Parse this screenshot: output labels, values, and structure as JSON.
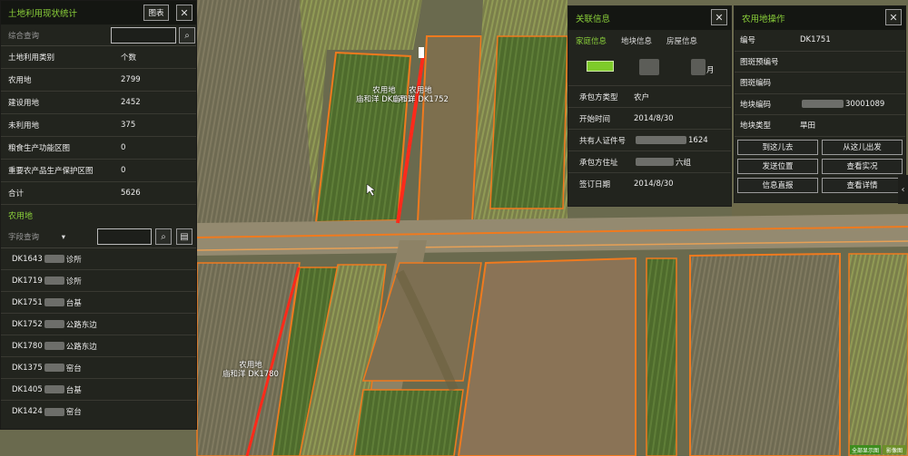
{
  "map": {
    "parcel_labels": [
      {
        "line1": "农用地",
        "line2": "庙和洋 DK1751"
      },
      {
        "line1": "农用地",
        "line2": "庙和洋 DK1752"
      },
      {
        "line1": "农用地",
        "line2": "庙和洋 DK1780"
      }
    ],
    "mini_btn_1": "全部显示图",
    "mini_btn_2": "影像图",
    "side_tab_icon": "‹"
  },
  "stats_panel": {
    "title": "土地利用现状统计",
    "chart_button": "图表",
    "search_placeholder": "综合查询",
    "header": {
      "k": "土地利用类别",
      "v": "个数"
    },
    "rows": [
      {
        "k": "农用地",
        "v": "2799"
      },
      {
        "k": "建设用地",
        "v": "2452"
      },
      {
        "k": "未利用地",
        "v": "375"
      },
      {
        "k": "粮食生产功能区图",
        "v": "0"
      },
      {
        "k": "重要农产品生产保护区图",
        "v": "0"
      },
      {
        "k": "合计",
        "v": "5626"
      }
    ],
    "subtitle": "农用地",
    "field_select": "字段查询",
    "list": [
      {
        "code": "DK1643",
        "place": "诊所"
      },
      {
        "code": "DK1719",
        "place": "诊所"
      },
      {
        "code": "DK1751",
        "place": "台基"
      },
      {
        "code": "DK1752",
        "place": "公路东边"
      },
      {
        "code": "DK1780",
        "place": "公路东边"
      },
      {
        "code": "DK1375",
        "place": "窑台"
      },
      {
        "code": "DK1405",
        "place": "台基"
      },
      {
        "code": "DK1424",
        "place": "窑台"
      }
    ]
  },
  "info_panel": {
    "title": "关联信息",
    "tabs": [
      "家庭信息",
      "地块信息",
      "房屋信息"
    ],
    "img_text": "月",
    "rows": [
      {
        "k": "承包方类型",
        "v": "农户"
      },
      {
        "k": "开始时间",
        "v": "2014/8/30"
      },
      {
        "k": "共有人证件号",
        "v": "1624"
      },
      {
        "k": "承包方住址",
        "v": "六组"
      },
      {
        "k": "签订日期",
        "v": "2014/8/30"
      }
    ]
  },
  "ops_panel": {
    "title": "农用地操作",
    "rows": [
      {
        "k": "编号",
        "v": "DK1751"
      },
      {
        "k": "图斑预编号",
        "v": ""
      },
      {
        "k": "图斑编码",
        "v": ""
      },
      {
        "k": "地块编码",
        "v": "30001089"
      },
      {
        "k": "地块类型",
        "v": "旱田"
      }
    ],
    "buttons": [
      "到这儿去",
      "从这儿出发",
      "发送位置",
      "查看实况",
      "信息直报",
      "查看详情"
    ]
  },
  "colors": {
    "accent": "#8bd13a",
    "parcel_outline": "#f07a1e",
    "selected": "#ff2a1a"
  }
}
